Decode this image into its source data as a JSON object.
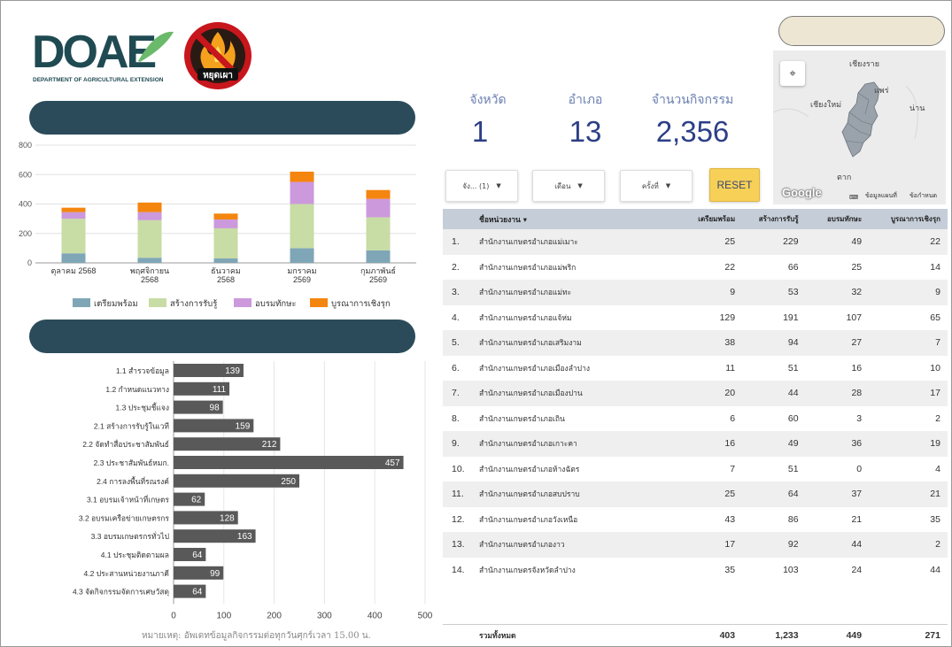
{
  "logos": {
    "doae_text": "DOAE",
    "doae_caption": "DEPARTMENT OF AGRICULTURAL EXTENSION",
    "stop_text": "หยุดเผา"
  },
  "scorecards": [
    {
      "label": "จังหวัด",
      "value": "1"
    },
    {
      "label": "อำเภอ",
      "value": "13"
    },
    {
      "label": "จำนวนกิจกรรม",
      "value": "2,356"
    }
  ],
  "controls": {
    "filters": [
      {
        "label": "จัง... (1)"
      },
      {
        "label": "เดือน"
      },
      {
        "label": "ครั้งที่"
      }
    ],
    "reset_label": "RESET"
  },
  "map": {
    "labels": [
      "เชียงราย",
      "เชียงใหม่",
      "แพร่",
      "น่าน",
      "ตาก"
    ],
    "google": "Google",
    "footer_data": "ข้อมูลแผนที่",
    "footer_terms": "ข้อกำหนด",
    "region_color": "#9aa3ab"
  },
  "chart_data": [
    {
      "type": "bar",
      "stacked": true,
      "categories": [
        [
          "ตุลาคม 2568"
        ],
        [
          "พฤศจิกายน",
          "2568"
        ],
        [
          "ธันวาคม",
          "2568"
        ],
        [
          "มกราคม",
          "2569"
        ],
        [
          "กุมภาพันธ์",
          "2569"
        ]
      ],
      "series": [
        {
          "name": "เตรียมพร้อม",
          "color": "#7fa6b7",
          "values": [
            65,
            35,
            30,
            100,
            85
          ]
        },
        {
          "name": "สร้างการรับรู้",
          "color": "#c8dca5",
          "values": [
            235,
            255,
            205,
            300,
            225
          ]
        },
        {
          "name": "อบรมทักษะ",
          "color": "#cc99dd",
          "values": [
            45,
            55,
            60,
            150,
            125
          ]
        },
        {
          "name": "บูรณาการเชิงรุก",
          "color": "#f4850f",
          "values": [
            30,
            65,
            40,
            70,
            60
          ]
        }
      ],
      "ylim": [
        0,
        800
      ],
      "yticks": [
        0,
        200,
        400,
        600,
        800
      ],
      "grid": true,
      "legend": "bottom"
    },
    {
      "type": "bar",
      "orientation": "horizontal",
      "color": "#595959",
      "categories": [
        "1.1 สำรวจข้อมูล",
        "1.2 กำหนดแนวทาง",
        "1.3 ประชุมชี้แจง",
        "2.1 สร้างการรับรู้ในเวที",
        "2.2 จัดทำสื่อประชาสัมพันธ์",
        "2.3 ประชาสัมพันธ์หมก.",
        "2.4 การลงพื้นที่รณรงค์",
        "3.1 อบรมเจ้าหน้าที่เกษตร",
        "3.2 อบรมเครือข่ายเกษตรกร",
        "3.3 อบรมเกษตรกรทั่วไป",
        "4.1 ประชุมติดตามผล",
        "4.2 ประสานหน่วยงานภาคี",
        "4.3 จัดกิจกรรมจัดการเศษวัสดุ"
      ],
      "values": [
        139,
        111,
        98,
        159,
        212,
        457,
        250,
        62,
        128,
        163,
        64,
        99,
        64
      ],
      "xlim": [
        0,
        500
      ],
      "xticks": [
        0,
        100,
        200,
        300,
        400,
        500
      ],
      "grid": true
    }
  ],
  "table": {
    "headers": [
      "ชื่อหน่วยงาน",
      "เตรียมพร้อม",
      "สร้างการรับรู้",
      "อบรมทักษะ",
      "บูรณาการเชิงรุก"
    ],
    "rows": [
      {
        "idx": "1.",
        "name": "สำนักงานเกษตรอำเภอแม่เมาะ",
        "v": [
          "25",
          "229",
          "49",
          "22"
        ]
      },
      {
        "idx": "2.",
        "name": "สำนักงานเกษตรอำเภอแม่พริก",
        "v": [
          "22",
          "66",
          "25",
          "14"
        ]
      },
      {
        "idx": "3.",
        "name": "สำนักงานเกษตรอำเภอแม่ทะ",
        "v": [
          "9",
          "53",
          "32",
          "9"
        ]
      },
      {
        "idx": "4.",
        "name": "สำนักงานเกษตรอำเภอแจ้ห่ม",
        "v": [
          "129",
          "191",
          "107",
          "65"
        ]
      },
      {
        "idx": "5.",
        "name": "สำนักงานเกษตรอำเภอเสริมงาม",
        "v": [
          "38",
          "94",
          "27",
          "7"
        ]
      },
      {
        "idx": "6.",
        "name": "สำนักงานเกษตรอำเภอเมืองลำปาง",
        "v": [
          "11",
          "51",
          "16",
          "10"
        ]
      },
      {
        "idx": "7.",
        "name": "สำนักงานเกษตรอำเภอเมืองปาน",
        "v": [
          "20",
          "44",
          "28",
          "17"
        ]
      },
      {
        "idx": "8.",
        "name": "สำนักงานเกษตรอำเภอเถิน",
        "v": [
          "6",
          "60",
          "3",
          "2"
        ]
      },
      {
        "idx": "9.",
        "name": "สำนักงานเกษตรอำเภอเกาะคา",
        "v": [
          "16",
          "49",
          "36",
          "19"
        ]
      },
      {
        "idx": "10.",
        "name": "สำนักงานเกษตรอำเภอห้างฉัตร",
        "v": [
          "7",
          "51",
          "0",
          "4"
        ]
      },
      {
        "idx": "11.",
        "name": "สำนักงานเกษตรอำเภอสบปราบ",
        "v": [
          "25",
          "64",
          "37",
          "21"
        ]
      },
      {
        "idx": "12.",
        "name": "สำนักงานเกษตรอำเภอวังเหนือ",
        "v": [
          "43",
          "86",
          "21",
          "35"
        ]
      },
      {
        "idx": "13.",
        "name": "สำนักงานเกษตรอำเภองาว",
        "v": [
          "17",
          "92",
          "44",
          "2"
        ]
      },
      {
        "idx": "14.",
        "name": "สำนักงานเกษตรจังหวัดลำปาง",
        "v": [
          "35",
          "103",
          "24",
          "44"
        ]
      }
    ],
    "total_label": "รวมทั้งหมด",
    "totals": [
      "403",
      "1,233",
      "449",
      "271"
    ],
    "sort_icon": "sort-down-icon"
  },
  "note": "หมายเหตุ: อัพเดทข้อมูลกิจกรรมต่อทุกวันศุกร์เวลา 15.00 น."
}
